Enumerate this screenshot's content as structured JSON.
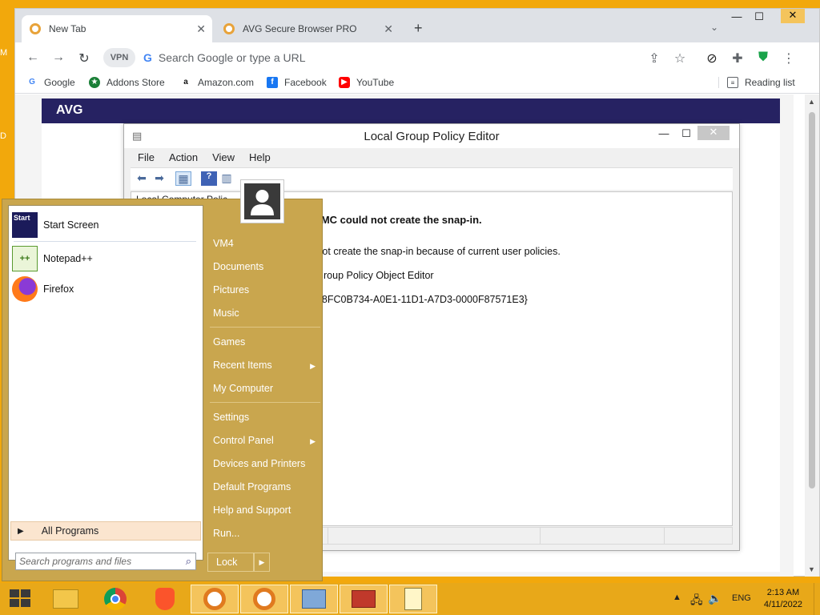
{
  "desktop": {
    "glimpse_top": "M",
    "glimpse_mid": "D"
  },
  "browser": {
    "tabs": [
      {
        "label": "New Tab"
      },
      {
        "label": "AVG Secure Browser PRO"
      }
    ],
    "newtab_symbol": "+",
    "vpn_label": "VPN",
    "omnibox_placeholder": "Search Google or type a URL",
    "omnibox_g": "G",
    "bookmarks": [
      {
        "label": "Google"
      },
      {
        "label": "Addons Store"
      },
      {
        "label": "Amazon.com"
      },
      {
        "label": "Facebook"
      },
      {
        "label": "YouTube"
      }
    ],
    "reading_list": "Reading list",
    "brand_logo": "AVG"
  },
  "gpe": {
    "title": "Local Group Policy Editor",
    "menu": [
      "File",
      "Action",
      "View",
      "Help"
    ],
    "tree_item": "Local Computer Polic",
    "error_title": "MMC could not create the snap-in.",
    "error_detail": "MMC cannot create the snap-in because of current user policies.",
    "name_line": "Name: Group Policy Object Editor",
    "clsid_line": "CLSID: {8FC0B734-A0E1-11D1-A7D3-0000F87571E3}"
  },
  "startmenu": {
    "pinned": [
      {
        "label": "Start Screen"
      },
      {
        "label": "Notepad++"
      },
      {
        "label": "Firefox"
      }
    ],
    "all_programs": "All Programs",
    "search_placeholder": "Search programs and files",
    "right_items": [
      {
        "label": "VM4"
      },
      {
        "label": "Documents"
      },
      {
        "label": "Pictures"
      },
      {
        "label": "Music"
      },
      {
        "label": "Games"
      },
      {
        "label": "Recent Items"
      },
      {
        "label": "My Computer"
      },
      {
        "label": "Settings"
      },
      {
        "label": "Control Panel"
      },
      {
        "label": "Devices and Printers"
      },
      {
        "label": "Default Programs"
      },
      {
        "label": "Help and Support"
      },
      {
        "label": "Run..."
      }
    ],
    "lock_label": "Lock",
    "start_screen_icon_text": "Start"
  },
  "taskbar": {
    "language": "ENG",
    "time": "2:13 AM",
    "date": "4/11/2022"
  },
  "colors": {
    "desktop_bg": "#f2a80c",
    "taskbar_bg": "#e8a819",
    "startmenu_bg": "#c9a64e",
    "avg_header": "#262262"
  }
}
